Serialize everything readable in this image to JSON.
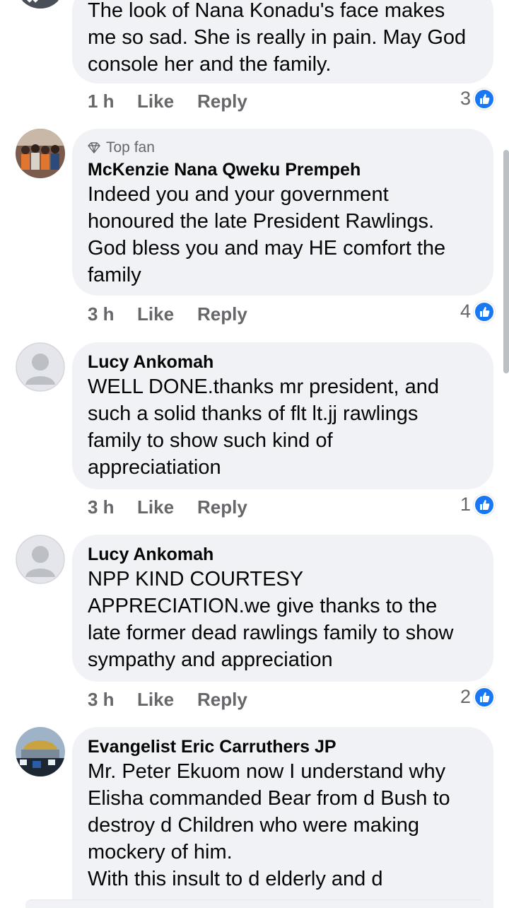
{
  "comments": [
    {
      "author": "",
      "badge": "",
      "lines": [
        "The look of Nana Konadu's face makes",
        "me so sad. She is really in pain. May God",
        "console her and the family."
      ],
      "time": "1 h",
      "like_label": "Like",
      "reply_label": "Reply",
      "reactions": "3"
    },
    {
      "author": "McKenzie Nana Qweku Prempeh",
      "badge": "Top fan",
      "lines": [
        "Indeed you and your government",
        "honoured the late President Rawlings.",
        "God bless you and may HE comfort the",
        "family"
      ],
      "time": "3 h",
      "like_label": "Like",
      "reply_label": "Reply",
      "reactions": "4"
    },
    {
      "author": "Lucy Ankomah",
      "badge": "",
      "lines": [
        "WELL DONE.thanks mr president, and",
        "such a solid thanks of flt lt.jj rawlings",
        "family to show such kind of",
        "appreciatiation"
      ],
      "time": "3 h",
      "like_label": "Like",
      "reply_label": "Reply",
      "reactions": "1"
    },
    {
      "author": "Lucy Ankomah",
      "badge": "",
      "lines": [
        "NPP KIND COURTESY",
        "APPRECIATION.we give thanks to the",
        "late former dead rawlings family to show",
        "sympathy and appreciation"
      ],
      "time": "3 h",
      "like_label": "Like",
      "reply_label": "Reply",
      "reactions": "2"
    },
    {
      "author": "Evangelist Eric Carruthers JP",
      "badge": "",
      "lines": [
        "Mr. Peter Ekuom now I understand why",
        "Elisha commanded Bear from d Bush to",
        "destroy d Children who were making",
        "mockery of him.",
        "With this insult to d elderly and d"
      ],
      "time": "",
      "like_label": "",
      "reply_label": "",
      "reactions": ""
    }
  ],
  "colors": {
    "bubble": "#f0f2f5",
    "meta_text": "#65676b",
    "like_blue": "#1877f2"
  },
  "icons": {
    "badge": "diamond-icon",
    "reaction": "thumbs-up-icon"
  }
}
